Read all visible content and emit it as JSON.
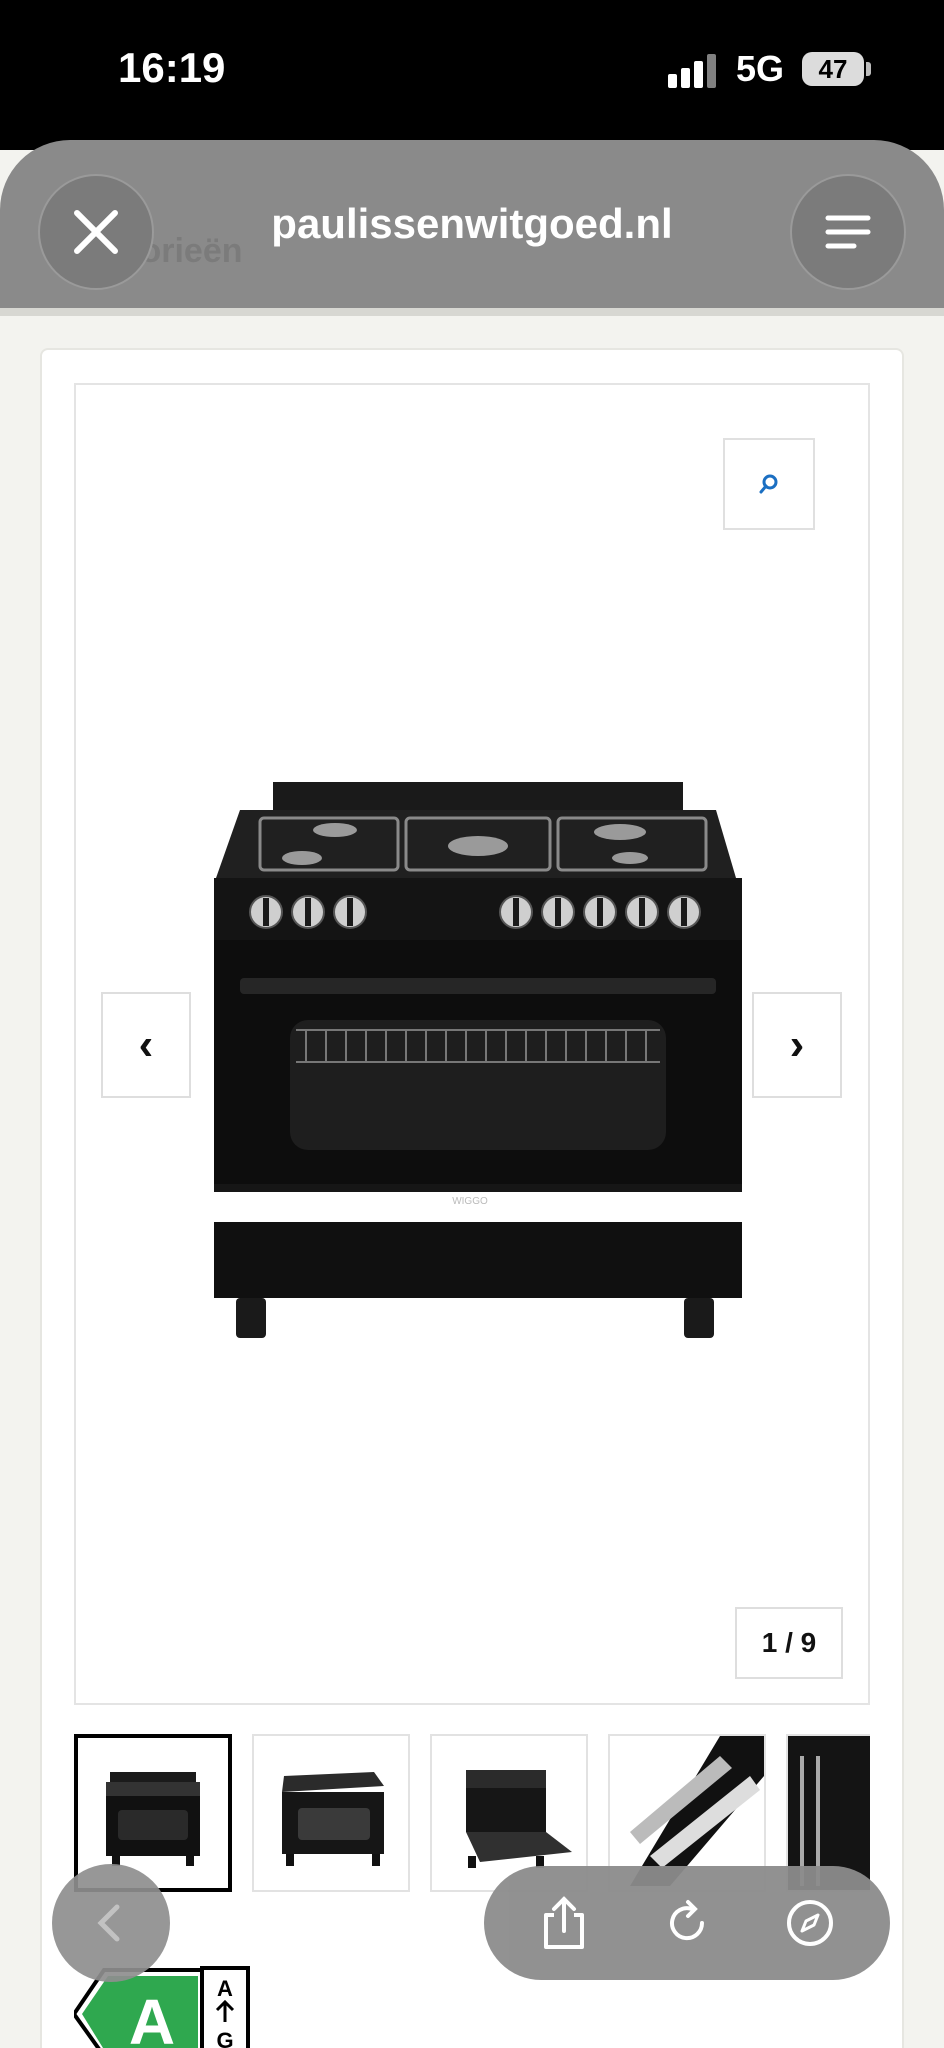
{
  "status_bar": {
    "time": "16:19",
    "network": "5G",
    "battery": "47"
  },
  "browser": {
    "url": "paulissenwitgoed.nl",
    "ghost_heading": "Categorieën",
    "close_icon": "close-icon",
    "menu_icon": "menu-lines-icon"
  },
  "gallery": {
    "counter": "1 / 9",
    "prev_label": "‹",
    "next_label": "›",
    "brand_on_product": "WIGGO",
    "zoom_icon": "search-icon",
    "thumbnails": [
      {
        "name": "front-view",
        "active": true
      },
      {
        "name": "angled-view",
        "active": false
      },
      {
        "name": "door-open-view",
        "active": false
      },
      {
        "name": "rails-detail",
        "active": false
      },
      {
        "name": "interior-detail",
        "active": false
      }
    ]
  },
  "energy_label": {
    "class": "A",
    "top": "A",
    "bottom": "G"
  },
  "bottom_bar": {
    "back_icon": "chevron-left-icon",
    "share_icon": "share-icon",
    "reload_icon": "reload-icon",
    "compass_icon": "compass-icon"
  },
  "colors": {
    "toolbar_gray": "#8a8a8a",
    "energy_green": "#2fa84f",
    "accent_blue": "#1b6fc2"
  }
}
